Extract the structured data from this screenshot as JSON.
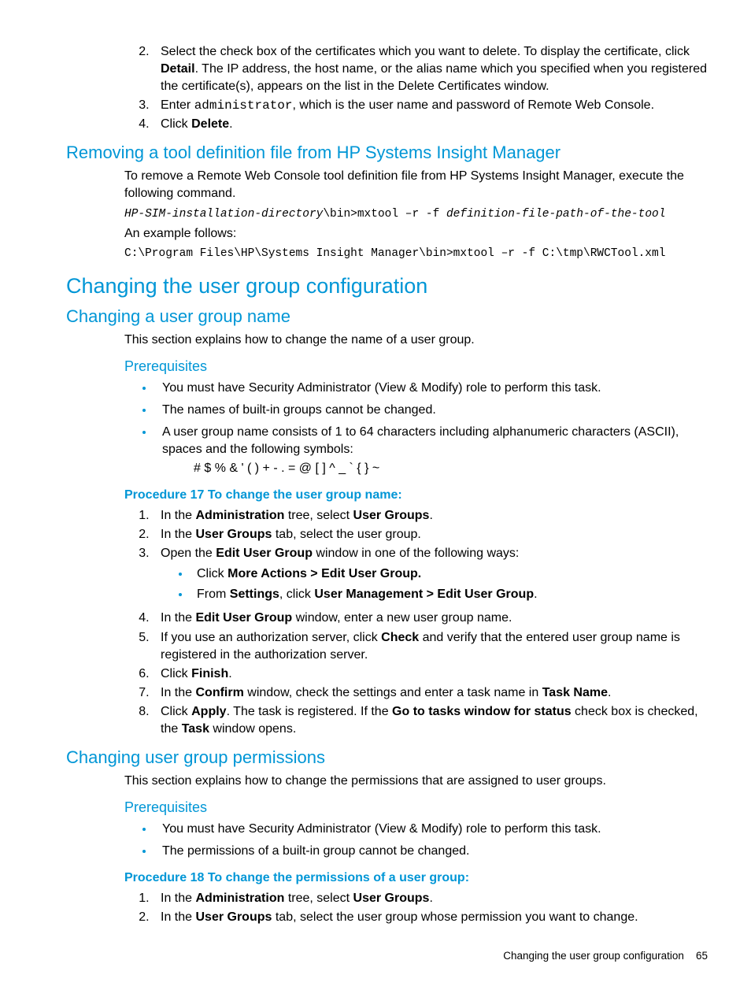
{
  "top_list": {
    "i2a": "Select the check box of the certificates which you want to delete. To display the certificate, click ",
    "i2b": "Detail",
    "i2c": ". The IP address, the host name, or the alias name which you specified when you registered the certificate(s), appears on the list in the Delete Certificates window.",
    "i3a": "Enter ",
    "i3code": "administrator",
    "i3b": ", which is the user name and password of Remote Web Console.",
    "i4a": "Click ",
    "i4b": "Delete",
    "i4c": "."
  },
  "h_removing": "Removing a tool definition file from HP Systems Insight Manager",
  "removing": {
    "p1": "To remove a Remote Web Console tool definition file from HP Systems Insight Manager, execute the following command.",
    "code1a": "HP-SIM-installation-directory",
    "code1b": "\\bin>mxtool –r -f ",
    "code1c": "definition-file-path-of-the-tool",
    "p2": "An example follows:",
    "code2": "C:\\Program Files\\HP\\Systems Insight Manager\\bin>mxtool –r -f C:\\tmp\\RWCTool.xml"
  },
  "h_changing_cfg": "Changing the user group configuration",
  "h_changing_name": "Changing a user group name",
  "name_intro": "This section explains how to change the name of a user group.",
  "h_prereq1": "Prerequisites",
  "prereq1": {
    "b1": "You must have Security Administrator (View & Modify) role to perform this task.",
    "b2": "The names of built-in groups cannot be changed.",
    "b3": "A user group name consists of 1 to 64 characters including alphanumeric characters (ASCII), spaces and the following symbols:",
    "b3sym": "# $ % & ' ( ) + - . = @ [ ] ^ _ ` { } ~"
  },
  "proc17_title": "Procedure 17 To change the user group name:",
  "proc17": {
    "s1a": "In the ",
    "s1b": "Administration",
    "s1c": " tree, select ",
    "s1d": "User Groups",
    "s1e": ".",
    "s2a": "In the ",
    "s2b": "User Groups",
    "s2c": " tab, select the user group.",
    "s3a": "Open the ",
    "s3b": "Edit User Group",
    "s3c": " window in one of the following ways:",
    "s3i1a": "Click ",
    "s3i1b": "More Actions > Edit User Group.",
    "s3i2a": "From ",
    "s3i2b": "Settings",
    "s3i2c": ", click ",
    "s3i2d": "User Management > Edit User Group",
    "s3i2e": ".",
    "s4a": "In the ",
    "s4b": "Edit User Group",
    "s4c": " window, enter a new user group name.",
    "s5a": "If you use an authorization server, click ",
    "s5b": "Check",
    "s5c": " and verify that the entered user group name is registered in the authorization server.",
    "s6a": "Click ",
    "s6b": "Finish",
    "s6c": ".",
    "s7a": "In the ",
    "s7b": "Confirm",
    "s7c": " window, check the settings and enter a task name in ",
    "s7d": "Task Name",
    "s7e": ".",
    "s8a": "Click ",
    "s8b": "Apply",
    "s8c": ". The task is registered. If the ",
    "s8d": "Go to tasks window for status",
    "s8e": " check box is checked, the ",
    "s8f": "Task",
    "s8g": " window opens."
  },
  "h_changing_perm": "Changing user group permissions",
  "perm_intro": "This section explains how to change the permissions that are assigned to user groups.",
  "h_prereq2": "Prerequisites",
  "prereq2": {
    "b1": "You must have Security Administrator (View & Modify) role to perform this task.",
    "b2": "The permissions of a built-in group cannot be changed."
  },
  "proc18_title": "Procedure 18 To change the permissions of a user group:",
  "proc18": {
    "s1a": "In the ",
    "s1b": "Administration",
    "s1c": " tree, select ",
    "s1d": "User Groups",
    "s1e": ".",
    "s2a": "In the ",
    "s2b": "User Groups",
    "s2c": " tab, select the user group whose permission you want to change."
  },
  "footer_text": "Changing the user group configuration",
  "footer_page": "65"
}
